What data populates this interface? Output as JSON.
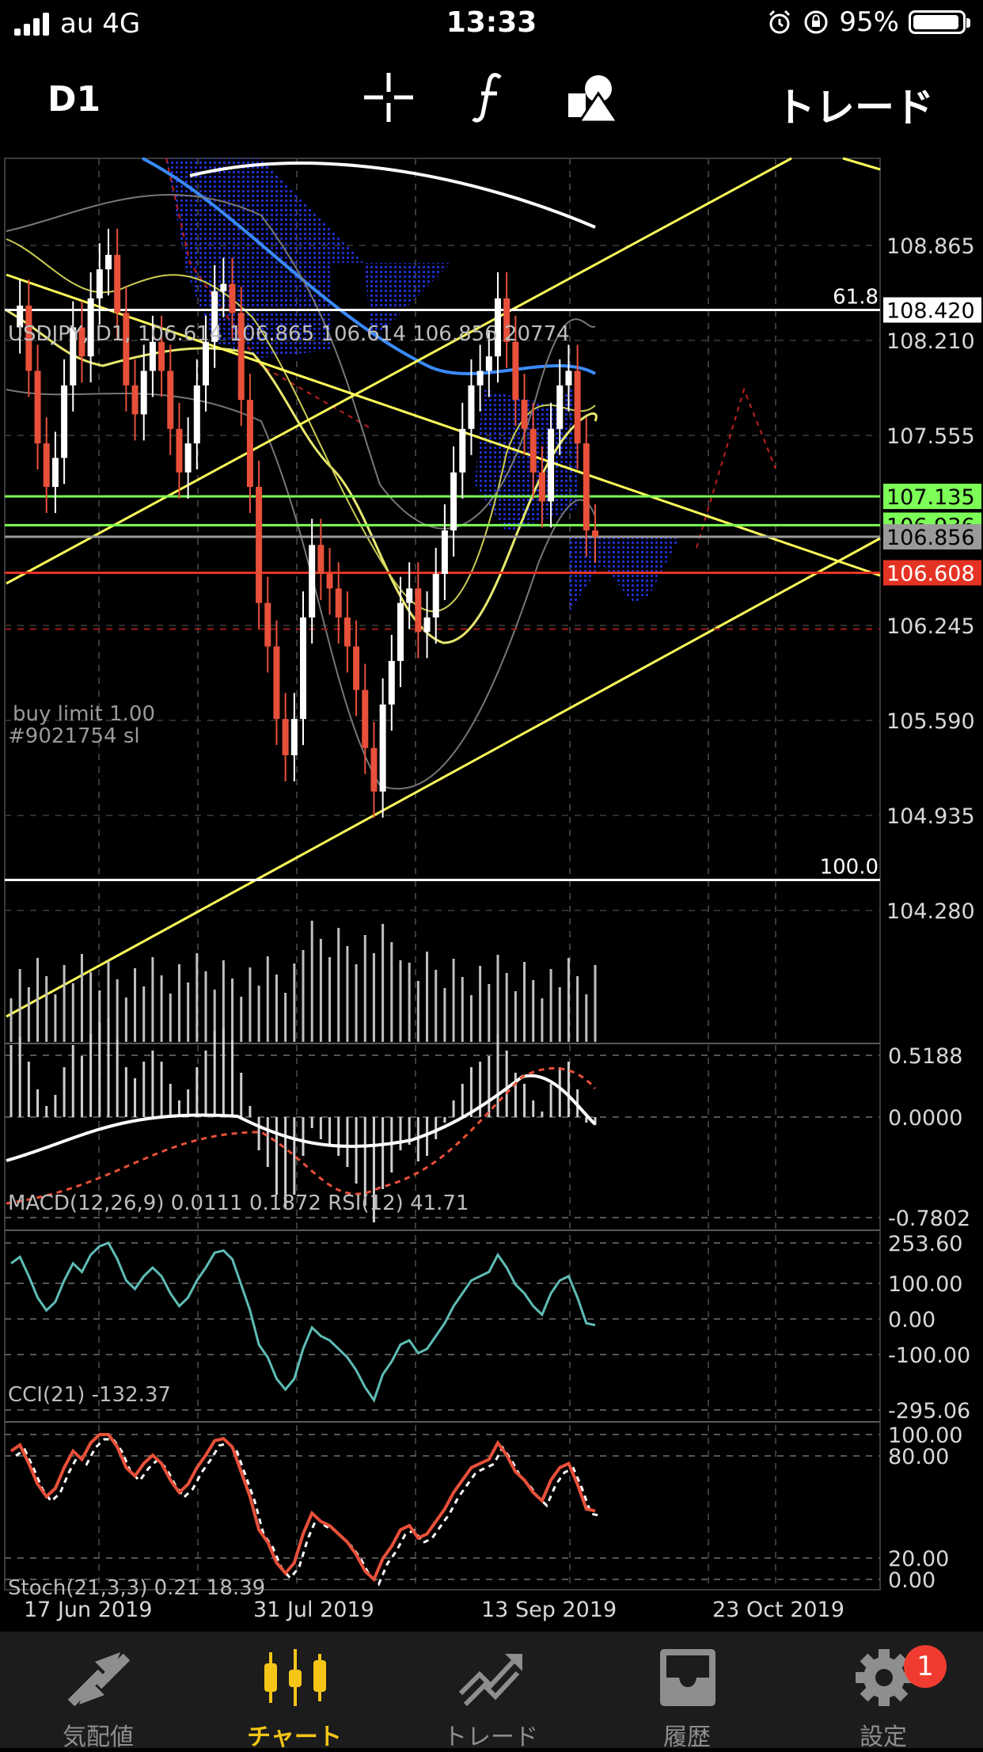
{
  "status_bar": {
    "carrier": "au 4G",
    "time": "13:33",
    "battery_percent_label": "95%",
    "battery_level": 0.95
  },
  "toolbar": {
    "timeframe": "D1",
    "trade_label": "トレード",
    "tools": [
      "crosshair-icon",
      "function-icon",
      "objects-icon"
    ]
  },
  "chart_header": {
    "info": "USDJPY, D1, 106.614 106.865 106.614 106.856 20774"
  },
  "order_label": {
    "line1": "buy limit 1.00",
    "line2": "#9021754 sl"
  },
  "chart_data": {
    "type": "candlestick",
    "symbol": "USDJPY",
    "timeframe": "D1",
    "last_bar": {
      "open": 106.614,
      "high": 106.865,
      "low": 106.614,
      "close": 106.856,
      "volume": 20774
    },
    "price_axis": {
      "ticks": [
        108.865,
        108.21,
        107.555,
        106.245,
        105.59,
        104.935,
        104.28
      ]
    },
    "horizontal_lines": [
      {
        "price": 108.42,
        "label": "108.420",
        "fib_label": "61.8",
        "color": "#ffffff"
      },
      {
        "price": 107.135,
        "label": "107.135",
        "color": "#7cff56"
      },
      {
        "price": 106.936,
        "label": "106.936",
        "color": "#7cff56"
      },
      {
        "price": 106.856,
        "label": "106.856",
        "color": "#9a9a9a"
      },
      {
        "price": 106.608,
        "label": "106.608",
        "color": "#e53323"
      },
      {
        "price": 104.49,
        "fib_label": "100.0",
        "color": "#ffffff"
      }
    ],
    "x_axis": {
      "labels": [
        "17 Jun 2019",
        "31 Jul 2019",
        "13 Sep 2019",
        "23 Oct 2019"
      ]
    },
    "close_path": [
      108.3,
      108.45,
      108.0,
      107.5,
      107.2,
      107.4,
      107.9,
      108.3,
      108.1,
      108.5,
      108.7,
      108.8,
      108.4,
      107.9,
      107.7,
      108.0,
      108.2,
      108.0,
      107.6,
      107.3,
      107.5,
      107.9,
      108.2,
      108.55,
      108.6,
      108.4,
      107.8,
      107.2,
      106.4,
      106.1,
      105.6,
      105.35,
      105.6,
      106.3,
      106.8,
      106.6,
      106.5,
      106.3,
      106.1,
      105.8,
      105.4,
      105.1,
      105.7,
      106.0,
      106.4,
      106.5,
      106.2,
      106.3,
      106.6,
      106.9,
      107.3,
      107.6,
      107.9,
      108.0,
      108.1,
      108.5,
      108.2,
      107.8,
      107.6,
      107.3,
      107.1,
      107.6,
      107.9,
      108.0,
      107.5,
      106.9,
      106.856
    ],
    "indicators": {
      "macd": {
        "label": "MACD(12,26,9) 0.0111 0.1872 RSI(12) 41.71",
        "ticks": [
          "0.5188",
          "0.0000",
          "-0.7802"
        ]
      },
      "cci": {
        "label": "CCI(21) -132.37",
        "ticks": [
          "253.60",
          "100.00",
          "0.00",
          "-100.00",
          "-295.06"
        ]
      },
      "stoch": {
        "label": "Stoch(21,3,3) 0.21 18.39",
        "ticks": [
          "100.00",
          "80.00",
          "20.00",
          "0.00"
        ]
      }
    }
  },
  "tabs": [
    {
      "label": "気配値",
      "icon": "quotes-icon",
      "active": false
    },
    {
      "label": "チャート",
      "icon": "chart-icon",
      "active": true
    },
    {
      "label": "トレード",
      "icon": "trade-icon",
      "active": false
    },
    {
      "label": "履歴",
      "icon": "history-icon",
      "active": false
    },
    {
      "label": "設定",
      "icon": "settings-icon",
      "active": false
    }
  ],
  "settings_badge": "1",
  "colors": {
    "accent": "#f5c518",
    "bull": "#ffffff",
    "bear": "#e8503a",
    "trendline": "#ffff5a",
    "ma_blue": "#3a8bff"
  }
}
